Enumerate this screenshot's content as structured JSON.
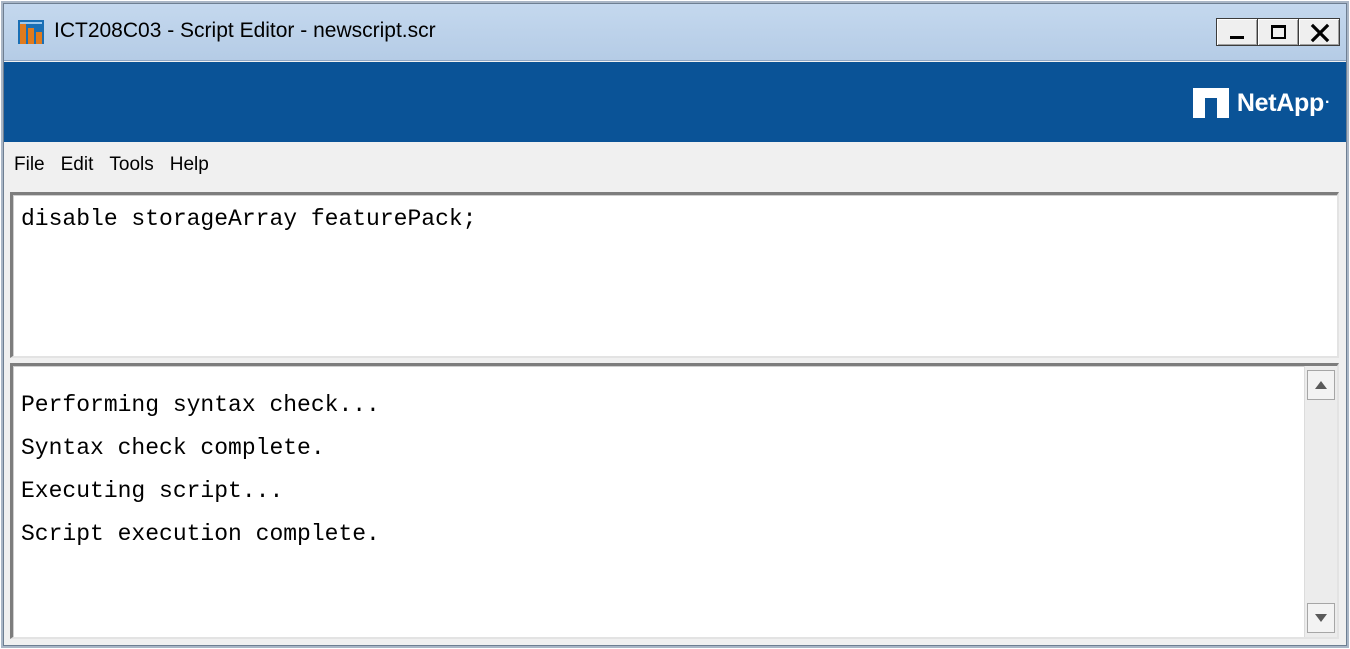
{
  "window": {
    "title": "ICT208C03 - Script Editor - newscript.scr",
    "icon": "array-manager-icon",
    "controls": {
      "minimize": "minimize-icon",
      "maximize": "maximize-icon",
      "close": "close-icon"
    }
  },
  "banner": {
    "brand_name": "NetApp",
    "brand_trademark": "·",
    "color": "#0a5397"
  },
  "menu": {
    "items": [
      {
        "label": "File"
      },
      {
        "label": "Edit"
      },
      {
        "label": "Tools"
      },
      {
        "label": "Help"
      }
    ]
  },
  "script_editor": {
    "lines": [
      "disable storageArray featurePack;"
    ]
  },
  "output": {
    "lines": [
      "Performing syntax check...",
      "Syntax check complete.",
      "Executing script...",
      "Script execution complete."
    ],
    "scroll_up_icon": "scroll-up-arrow-icon",
    "scroll_down_icon": "scroll-down-arrow-icon"
  }
}
